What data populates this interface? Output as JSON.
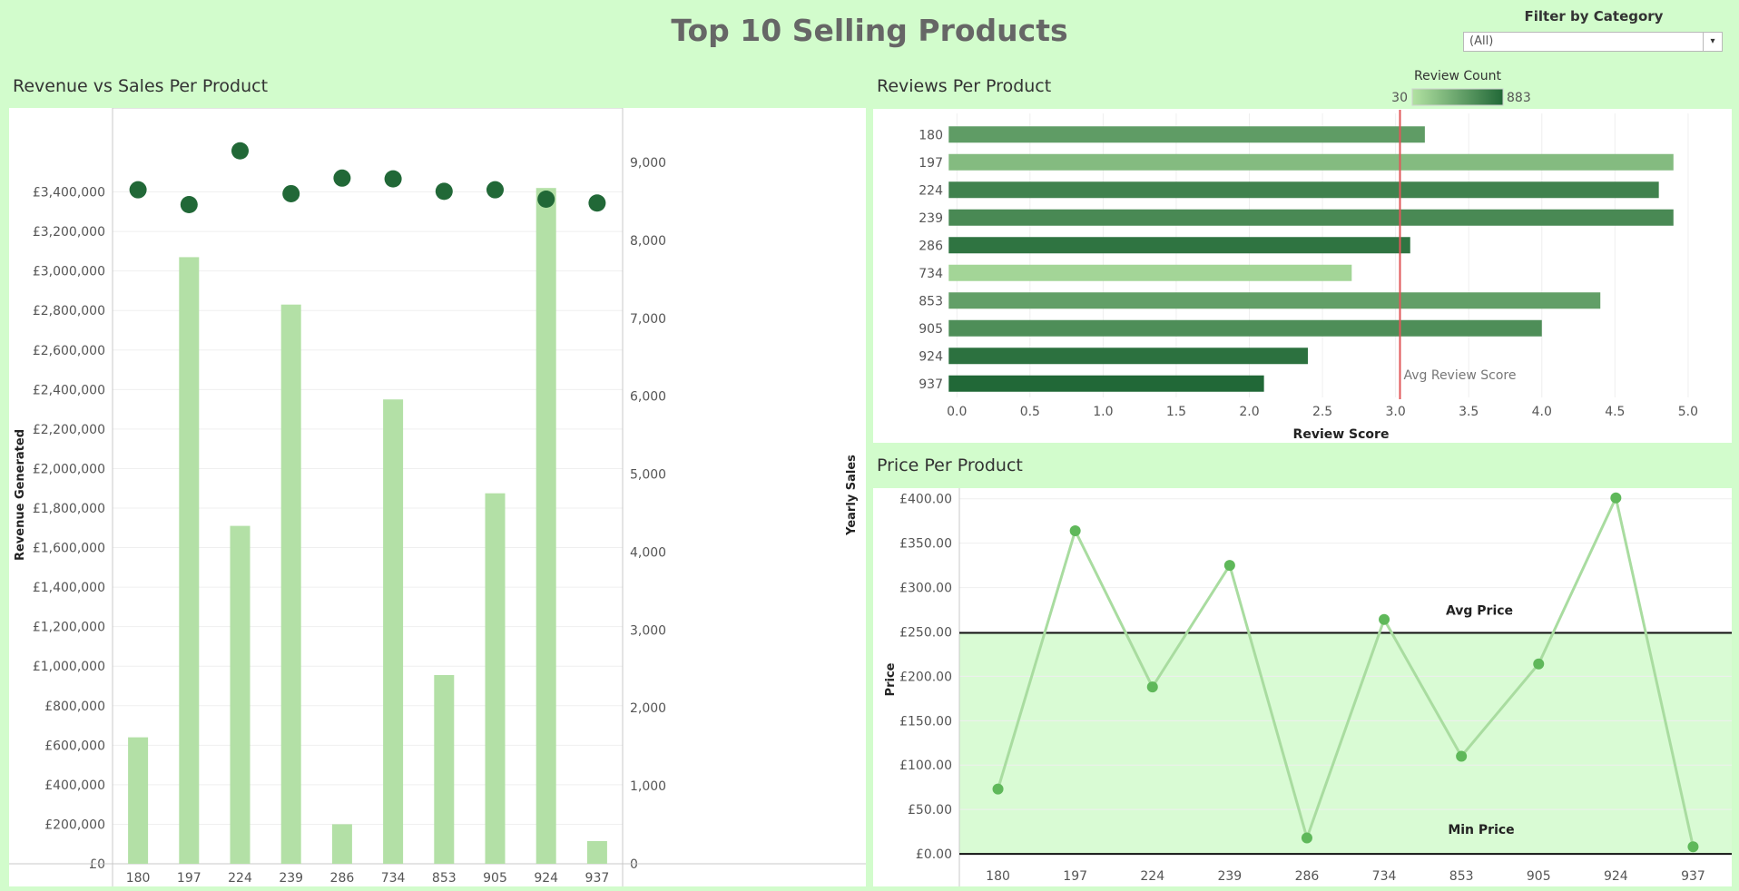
{
  "dashboard": {
    "title": "Top 10 Selling Products",
    "filter": {
      "label": "Filter by Category",
      "selected": "(All)",
      "icon": "chevron-down-icon"
    }
  },
  "colors": {
    "background": "#d2fccc",
    "bar_light": "#b3e0a6",
    "dot_dark": "#216837",
    "avg_review_line": "#e15759",
    "price_line": "#a9dca0",
    "price_dot": "#5fb85a",
    "price_band": "#d9fbd4"
  },
  "chart_data": [
    {
      "type": "bar",
      "title": "Revenue vs Sales Per Product",
      "categories": [
        "180",
        "197",
        "224",
        "239",
        "286",
        "734",
        "853",
        "905",
        "924",
        "937"
      ],
      "series": [
        {
          "name": "Revenue Generated",
          "axis": "left",
          "mark": "bar",
          "values": [
            640000,
            3070000,
            1710000,
            2830000,
            200000,
            2350000,
            955000,
            1875000,
            3420000,
            115000
          ]
        },
        {
          "name": "Yearly Sales",
          "axis": "right",
          "mark": "circle",
          "values": [
            8650,
            8460,
            9150,
            8600,
            8800,
            8790,
            8630,
            8650,
            8530,
            8480
          ]
        }
      ],
      "ylabel": "Revenue Generated",
      "ylim": [
        0,
        3600000
      ],
      "yticks": [
        0,
        200000,
        400000,
        600000,
        800000,
        1000000,
        1200000,
        1400000,
        1600000,
        1800000,
        2000000,
        2200000,
        2400000,
        2600000,
        2800000,
        3000000,
        3200000,
        3400000
      ],
      "ytick_labels": [
        "£0",
        "£200,000",
        "£400,000",
        "£600,000",
        "£800,000",
        "£1,000,000",
        "£1,200,000",
        "£1,400,000",
        "£1,600,000",
        "£1,800,000",
        "£2,000,000",
        "£2,200,000",
        "£2,400,000",
        "£2,600,000",
        "£2,800,000",
        "£3,000,000",
        "£3,200,000",
        "£3,400,000"
      ],
      "y2label": "Yearly Sales",
      "y2lim": [
        0,
        9700
      ],
      "y2ticks": [
        0,
        1000,
        2000,
        3000,
        4000,
        5000,
        6000,
        7000,
        8000,
        9000
      ],
      "y2tick_labels": [
        "0",
        "1,000",
        "2,000",
        "3,000",
        "4,000",
        "5,000",
        "6,000",
        "7,000",
        "8,000",
        "9,000"
      ],
      "grid": true
    },
    {
      "type": "bar",
      "orientation": "horizontal",
      "title": "Reviews Per Product",
      "categories": [
        "180",
        "197",
        "224",
        "239",
        "286",
        "734",
        "853",
        "905",
        "924",
        "937"
      ],
      "values": [
        3.2,
        4.9,
        4.8,
        4.9,
        3.1,
        2.7,
        4.4,
        4.0,
        2.4,
        2.1
      ],
      "color_values": [
        520,
        300,
        700,
        650,
        800,
        120,
        500,
        620,
        820,
        883
      ],
      "xlabel": "Review Score",
      "xlim": [
        -0.07,
        5.1
      ],
      "xticks": [
        0,
        0.5,
        1,
        1.5,
        2,
        2.5,
        3,
        3.5,
        4,
        4.5,
        5
      ],
      "xtick_labels": [
        "0.0",
        "0.5",
        "1.0",
        "1.5",
        "2.0",
        "2.5",
        "3.0",
        "3.5",
        "4.0",
        "4.5",
        "5.0"
      ],
      "reference_line": {
        "label": "Avg Review Score",
        "value": 3.03
      },
      "legend": {
        "title": "Review Count",
        "min": 30,
        "max": 883,
        "placement": "top-right"
      },
      "grid": true
    },
    {
      "type": "line",
      "title": "Price Per Product",
      "categories": [
        "180",
        "197",
        "224",
        "239",
        "286",
        "734",
        "853",
        "905",
        "924",
        "937"
      ],
      "values": [
        73,
        364,
        188,
        325,
        18,
        264,
        110,
        214,
        401,
        8
      ],
      "ylabel": "Price",
      "ylim": [
        -3,
        412
      ],
      "yticks": [
        0,
        50,
        100,
        150,
        200,
        250,
        300,
        350,
        400
      ],
      "ytick_labels": [
        "£0.00",
        "£50.00",
        "£100.00",
        "£150.00",
        "£200.00",
        "£250.00",
        "£300.00",
        "£350.00",
        "£400.00"
      ],
      "reference_lines": [
        {
          "label": "Avg Price",
          "value": 249
        },
        {
          "label": "Min Price",
          "value": 0
        }
      ],
      "grid": true
    }
  ]
}
